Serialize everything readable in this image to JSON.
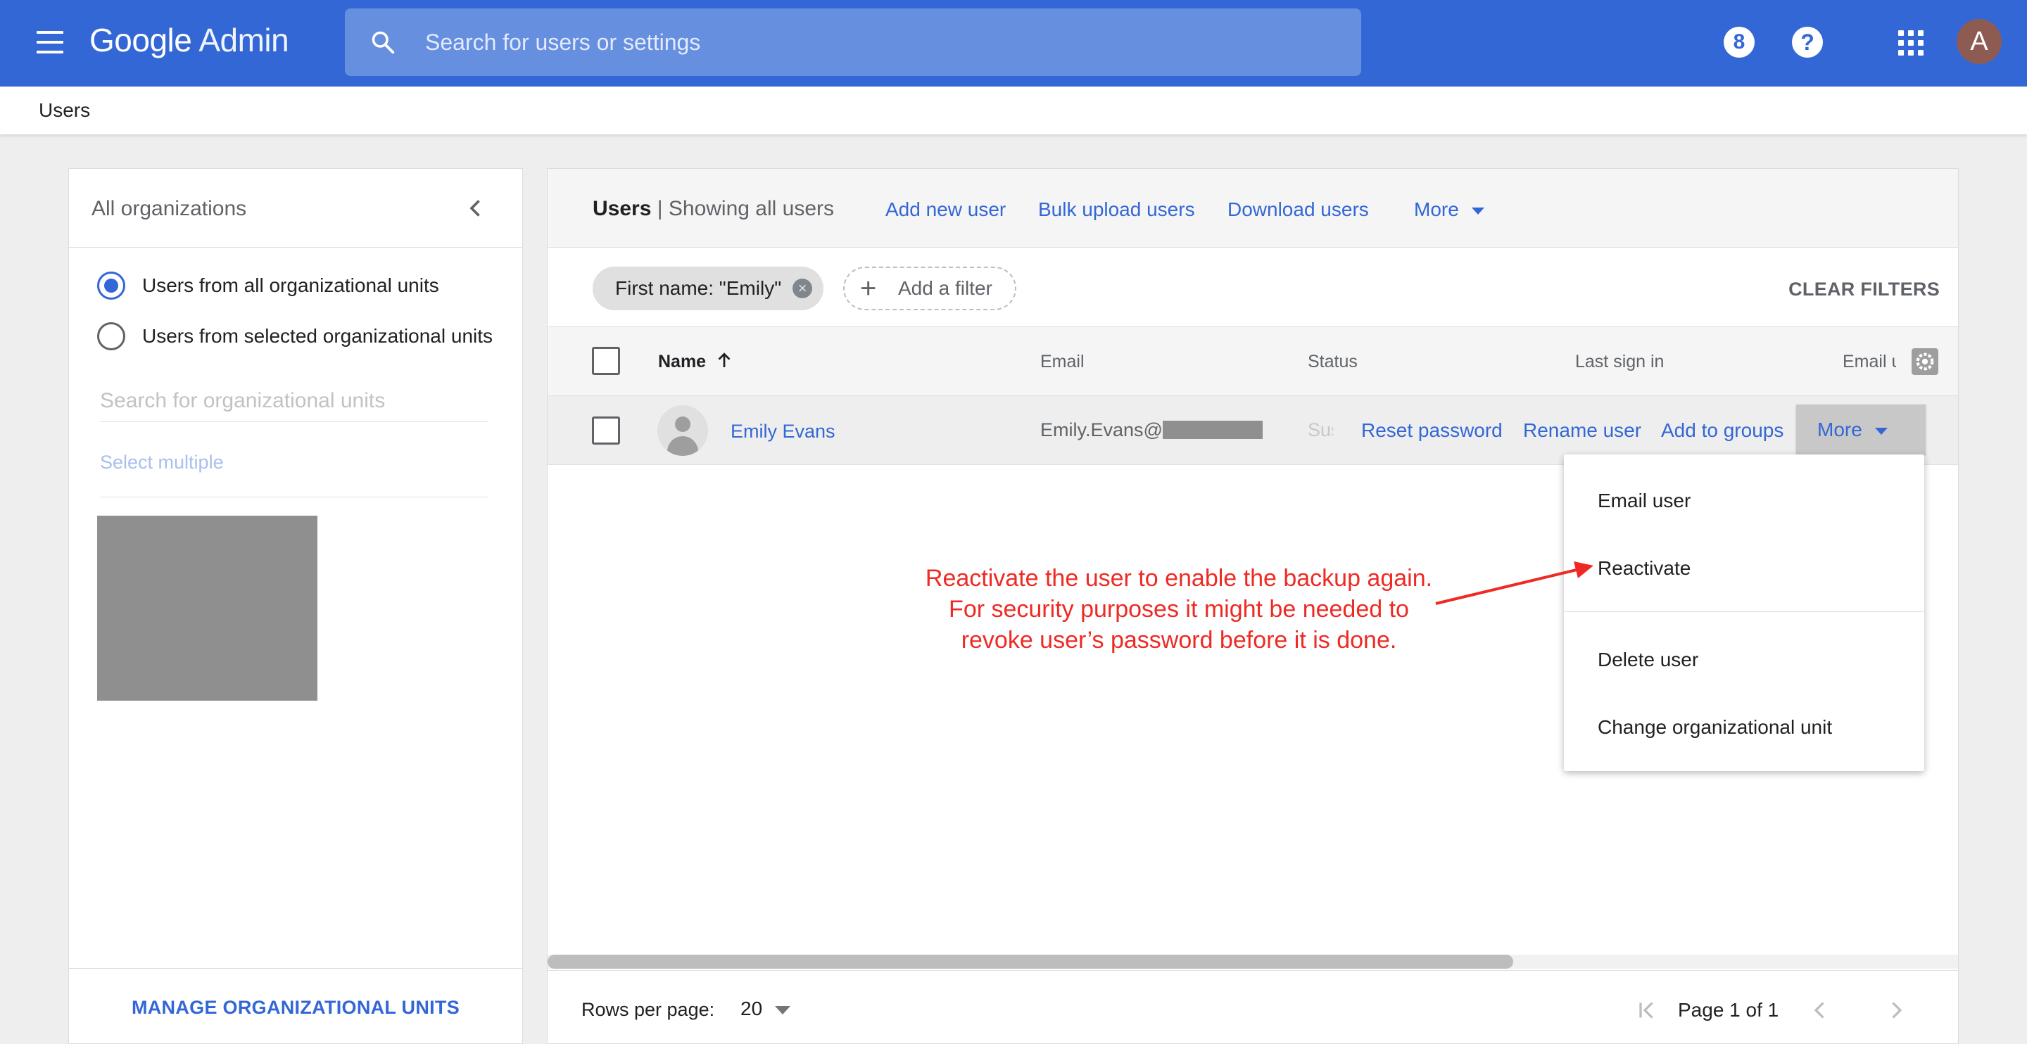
{
  "header": {
    "brand_google": "Google",
    "brand_admin": "Admin",
    "search_placeholder": "Search for users or settings",
    "notification_badge": "8",
    "help_glyph": "?",
    "avatar_initial": "A",
    "brand_color": "#3367d6",
    "icons": [
      "menu-icon",
      "search-icon",
      "notifications-icon",
      "help-icon",
      "apps-grid-icon",
      "account-avatar"
    ]
  },
  "breadcrumb": {
    "current": "Users"
  },
  "left_panel": {
    "title": "All organizations",
    "radio_options": [
      {
        "label": "Users from all organizational units",
        "selected": true
      },
      {
        "label": "Users from selected organizational units",
        "selected": false
      }
    ],
    "ou_search_placeholder": "Search for organizational units",
    "select_multiple": "Select multiple",
    "manage_link": "MANAGE ORGANIZATIONAL UNITS"
  },
  "main": {
    "title": "Users",
    "title_sep": " | ",
    "subtitle": "Showing all users",
    "actions": {
      "add_new_user": "Add new user",
      "bulk_upload": "Bulk upload users",
      "download": "Download users",
      "more": "More"
    },
    "filters": {
      "chip": "First name: \"Emily\"",
      "chip_remove": "×",
      "add_filter": "Add a filter",
      "clear": "CLEAR FILTERS"
    },
    "columns": [
      "Name",
      "Email",
      "Status",
      "Last sign in",
      "Email u"
    ],
    "rows": [
      {
        "name": "Emily Evans",
        "email_prefix": "Emily.Evans@",
        "status": "Susp",
        "actions": {
          "reset_password": "Reset password",
          "rename_user": "Rename user",
          "add_to_groups": "Add to groups",
          "more": "More"
        }
      }
    ],
    "pagination": {
      "rows_per_page_label": "Rows per page:",
      "rows_per_page_value": "20",
      "page_label": "Page 1 of 1"
    }
  },
  "more_menu": {
    "items": [
      "Email user",
      "Reactivate",
      "Delete user",
      "Change organizational unit"
    ]
  },
  "annotation": {
    "line1": "Reactivate the user to enable the backup again.",
    "line2": "For security purposes it might be needed to",
    "line3": "revoke user’s password before it is done.",
    "color": "#ee2a24"
  }
}
